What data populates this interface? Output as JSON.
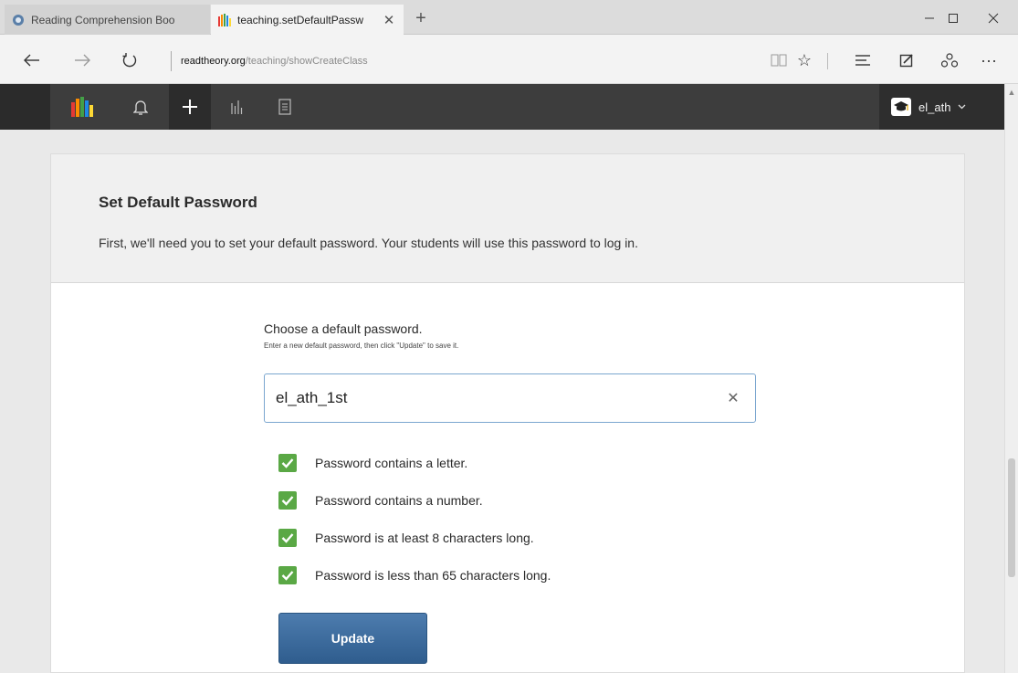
{
  "browser": {
    "tabs": [
      {
        "title": "Reading Comprehension Boo",
        "active": false,
        "icon": "site-favicon-icon"
      },
      {
        "title": "teaching.setDefaultPassw",
        "active": true,
        "icon": "readtheory-logo-icon"
      }
    ],
    "new_tab_label": "+",
    "url_domain": "readtheory.org",
    "url_path": "/teaching/showCreateClass"
  },
  "navbar": {
    "items": [
      "logo",
      "notifications",
      "create",
      "stats",
      "documents"
    ],
    "user_name": "el_ath"
  },
  "card": {
    "title": "Set Default Password",
    "subtitle": "First, we'll need you to set your default password. Your students will use this password to log in."
  },
  "form": {
    "label": "Choose a default password.",
    "hint": "Enter a new default password, then click \"Update\" to save it.",
    "password_value": "el_ath_1st",
    "requirements": [
      "Password contains a letter.",
      "Password contains a number.",
      "Password is at least 8 characters long.",
      "Password is less than 65 characters long."
    ],
    "button_label": "Update"
  },
  "colors": {
    "navbar_bg": "#3d3d3d",
    "check_green": "#5aa845",
    "button_blue": "#3a6a9c",
    "input_border": "#7aa6cf"
  }
}
